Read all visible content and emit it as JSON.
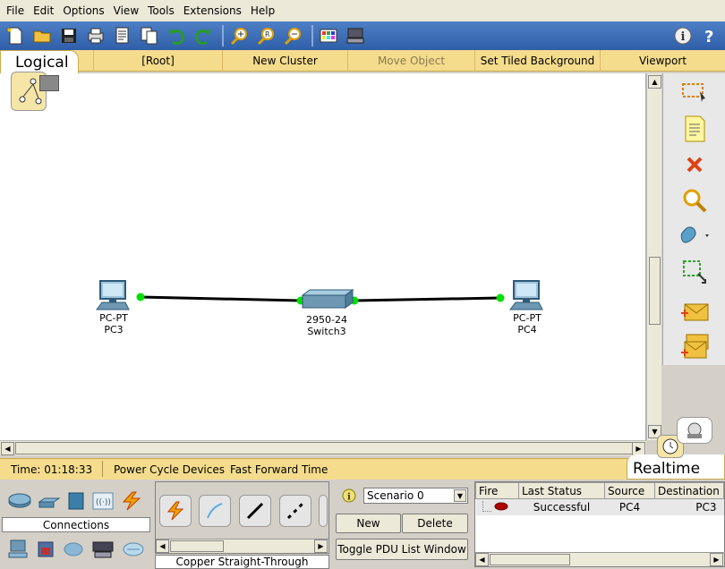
{
  "menu": [
    "File",
    "Edit",
    "Options",
    "View",
    "Tools",
    "Extensions",
    "Help"
  ],
  "workspace_bar": {
    "tab": "Logical",
    "root": "[Root]",
    "new_cluster": "New Cluster",
    "move_object": "Move Object",
    "tiled_bg": "Set Tiled Background",
    "viewport": "Viewport"
  },
  "devices": [
    {
      "model": "PC-PT",
      "name": "PC3"
    },
    {
      "model": "2950-24",
      "name": "Switch3"
    },
    {
      "model": "PC-PT",
      "name": "PC4"
    }
  ],
  "status": {
    "time": "Time: 01:18:33",
    "power_cycle": "Power Cycle Devices",
    "fast_forward": "Fast Forward Time",
    "mode": "Realtime"
  },
  "device_panel": {
    "category_label": "Connections",
    "selected_cable": "Copper Straight-Through"
  },
  "scenario": {
    "selected": "Scenario 0",
    "new_label": "New",
    "delete_label": "Delete",
    "toggle_label": "Toggle PDU List Window"
  },
  "pdu_table": {
    "headers": [
      "Fire",
      "Last Status",
      "Source",
      "Destination"
    ],
    "rows": [
      {
        "status": "Successful",
        "source": "PC4",
        "destination": "PC3"
      }
    ]
  },
  "colors": {
    "toolbar": "#3a6ab5",
    "workspace_bar": "#f5dc8c",
    "link_light": "#00e000",
    "fire_dot": "#b00000"
  }
}
